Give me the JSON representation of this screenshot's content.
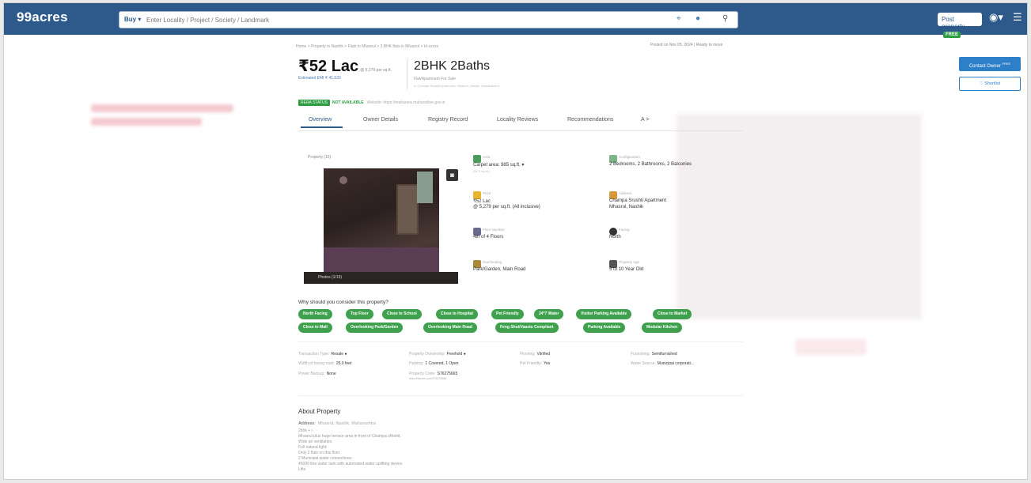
{
  "header": {
    "logo": "99acres",
    "buy_label": "Buy ▾",
    "search_placeholder": "Enter Locality / Project / Society / Landmark",
    "post_property_label": "Post property",
    "free_badge": "FREE"
  },
  "breadcrumb": "Home > Property in Nashik > Flats in Mhasrul > 2 BHK flats in Mhasrul > Id-xxxxx",
  "posted": "Posted on Nov 05, 2024  |  Ready to move",
  "listing": {
    "price": "₹52 Lac",
    "price_per": "@ 5,279 per sq.ft.",
    "emi": "Estimated EMI ₹ 41,533",
    "title": "2BHK 2Baths",
    "subtitle": "Flat/Apartment For Sale",
    "subtitle2": "in Champa Srushti Apartment, Mhasrul, Nashik, Maharashtra"
  },
  "rera": {
    "badge": "RERA STATUS",
    "status": "NOT AVAILABLE",
    "website": "Website: https://maharera.mahaonline.gov.in"
  },
  "tabs": [
    "Overview",
    "Owner Details",
    "Registry Record",
    "Locality Reviews",
    "Recommendations",
    "A >"
  ],
  "photo": {
    "label": "Property (15)",
    "count_label": "Photos (1/15)"
  },
  "details": {
    "area": {
      "label": "Area",
      "value": "Carpet area: 985 sq.ft. ▾",
      "sub": "(91.5 sq.m.)"
    },
    "config": {
      "label": "Configuration",
      "value": "2 Bedrooms, 2 Bathrooms, 2 Balconies"
    },
    "price": {
      "label": "Price",
      "value": "₹52 Lac",
      "value2": "@ 5,279 per sq.ft. (All inclusive)"
    },
    "address": {
      "label": "Address",
      "value": "Champa Srushti Apartment",
      "value2": "Mhasrul, Nashik"
    },
    "floor": {
      "label": "Floor Number",
      "value": "4th of 4 Floors"
    },
    "facing": {
      "label": "Facing",
      "value": "North"
    },
    "overlooking": {
      "label": "Overlooking",
      "value": "Park/Garden, Main Road"
    },
    "age": {
      "label": "Property Age",
      "value": "5 to 10 Year Old"
    }
  },
  "why": {
    "heading": "Why should you consider this property?",
    "chips": [
      "North Facing",
      "Top Floor",
      "Close to School",
      "Close to Hospital",
      "Pet Friendly",
      "24*7 Water",
      "Visitor Parking Available",
      "Close to Market",
      "Close to Mall",
      "Overlooking Park/Garden",
      "Overlooking Main Road",
      "Feng Shui/Vaastu Compliant",
      "Parking Available",
      "Modular Kitchen"
    ]
  },
  "more": {
    "transaction_k": "Transaction Type:",
    "transaction_v": "Resale",
    "width_k": "Width of facing road:",
    "width_v": "25.0 feet",
    "power_k": "Power Backup:",
    "power_v": "None",
    "ownership_k": "Property Ownership:",
    "ownership_v": "Freehold",
    "parking_k": "Parking:",
    "parking_v": "1 Covered, 1 Open",
    "code_k": "Property Code:",
    "code_v": "S76275665",
    "code_sub": "www.99acres.com/S76275665",
    "flooring_k": "Flooring:",
    "flooring_v": "Vitrified",
    "petfriendly_k": "Pet Friendly:",
    "petfriendly_v": "Yes",
    "furnishing_k": "Furnishing:",
    "furnishing_v": "Semifurnished",
    "water_k": "Water Source:",
    "water_v": "Municipal corporati..."
  },
  "about": {
    "heading": "About Property",
    "address_k": "Address:",
    "address_v": "Mhasrul, Nashik, Maharashtra",
    "lines": [
      "2bhk + i",
      "Mhasrul plus huge terrace area in front of Champa sRishtt.",
      "Wide air ventilation.",
      "Full natural light.",
      "Only 2 flats on this floor.",
      "2 Municipal water connections.",
      "45000 litre water tank with automated water uplifting device.",
      "Lifts"
    ]
  },
  "actions": {
    "contact": "Contact Owner",
    "contact_badge": "FREE",
    "shortlist": "♡ Shortlist"
  }
}
